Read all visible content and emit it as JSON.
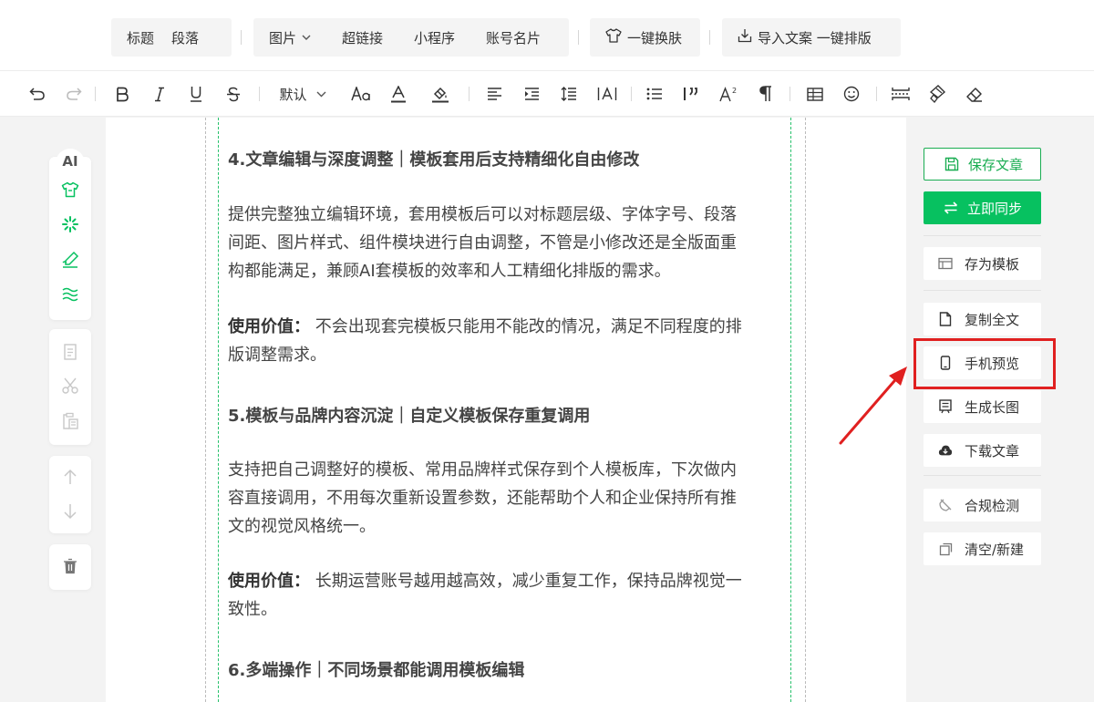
{
  "top_toolbar": {
    "title": "标题",
    "paragraph": "段落",
    "image": "图片",
    "hyperlink": "超链接",
    "miniprogram": "小程序",
    "account_card": "账号名片",
    "one_click_skin": "一键换肤",
    "import_article": "导入文案 一键排版"
  },
  "format_toolbar": {
    "font_size_default": "默认",
    "superscript_glyph": "A²"
  },
  "left_tools": {
    "ai_label": "AI"
  },
  "article": {
    "blocks": [
      {
        "type": "heading",
        "text": "4.文章编辑与深度调整｜模板套用后支持精细化自由修改"
      },
      {
        "type": "para",
        "lines": [
          "提供完整独立编辑环境，套用模板后可以对标题层级、字体字号、段落",
          "间距、图片样式、组件模块进行自由调整，不管是小修改还是全版面重",
          "构都能满足，兼顾AI套模板的效率和人工精细化排版的需求。"
        ]
      },
      {
        "type": "value",
        "label": "使用价值：",
        "lines": [
          "不会出现套完模板只能用不能改的情况，满足不同程度的排",
          "版调整需求。"
        ]
      },
      {
        "type": "heading",
        "text": "5.模板与品牌内容沉淀｜自定义模板保存重复调用"
      },
      {
        "type": "para",
        "lines": [
          "支持把自己调整好的模板、常用品牌样式保存到个人模板库，下次做内",
          "容直接调用，不用每次重新设置参数，还能帮助个人和企业保持所有推",
          "文的视觉风格统一。"
        ]
      },
      {
        "type": "value",
        "label": "使用价值：",
        "lines": [
          "长期运营账号越用越高效，减少重复工作，保持品牌视觉一",
          "致性。"
        ]
      },
      {
        "type": "heading",
        "text": "6.多端操作｜不同场景都能调用模板编辑"
      }
    ]
  },
  "right_actions": {
    "save_article": "保存文章",
    "sync_now": "立即同步",
    "save_as_template": "存为模板",
    "copy_all": "复制全文",
    "mobile_preview": "手机预览",
    "generate_long_image": "生成长图",
    "download_article": "下载文章",
    "compliance_check": "合规检测",
    "clear_new": "清空/新建"
  },
  "colors": {
    "accent_green": "#07c160",
    "highlight_red": "#e02020"
  }
}
